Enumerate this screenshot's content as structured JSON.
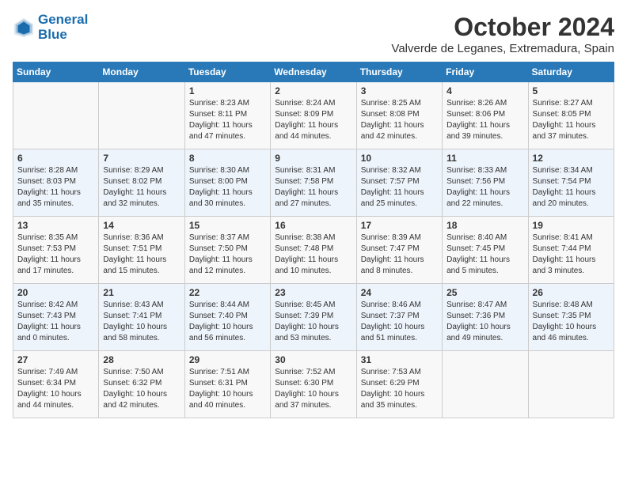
{
  "logo": {
    "line1": "General",
    "line2": "Blue"
  },
  "title": "October 2024",
  "location": "Valverde de Leganes, Extremadura, Spain",
  "weekdays": [
    "Sunday",
    "Monday",
    "Tuesday",
    "Wednesday",
    "Thursday",
    "Friday",
    "Saturday"
  ],
  "weeks": [
    [
      {
        "day": "",
        "sunrise": "",
        "sunset": "",
        "daylight": ""
      },
      {
        "day": "",
        "sunrise": "",
        "sunset": "",
        "daylight": ""
      },
      {
        "day": "1",
        "sunrise": "Sunrise: 8:23 AM",
        "sunset": "Sunset: 8:11 PM",
        "daylight": "Daylight: 11 hours and 47 minutes."
      },
      {
        "day": "2",
        "sunrise": "Sunrise: 8:24 AM",
        "sunset": "Sunset: 8:09 PM",
        "daylight": "Daylight: 11 hours and 44 minutes."
      },
      {
        "day": "3",
        "sunrise": "Sunrise: 8:25 AM",
        "sunset": "Sunset: 8:08 PM",
        "daylight": "Daylight: 11 hours and 42 minutes."
      },
      {
        "day": "4",
        "sunrise": "Sunrise: 8:26 AM",
        "sunset": "Sunset: 8:06 PM",
        "daylight": "Daylight: 11 hours and 39 minutes."
      },
      {
        "day": "5",
        "sunrise": "Sunrise: 8:27 AM",
        "sunset": "Sunset: 8:05 PM",
        "daylight": "Daylight: 11 hours and 37 minutes."
      }
    ],
    [
      {
        "day": "6",
        "sunrise": "Sunrise: 8:28 AM",
        "sunset": "Sunset: 8:03 PM",
        "daylight": "Daylight: 11 hours and 35 minutes."
      },
      {
        "day": "7",
        "sunrise": "Sunrise: 8:29 AM",
        "sunset": "Sunset: 8:02 PM",
        "daylight": "Daylight: 11 hours and 32 minutes."
      },
      {
        "day": "8",
        "sunrise": "Sunrise: 8:30 AM",
        "sunset": "Sunset: 8:00 PM",
        "daylight": "Daylight: 11 hours and 30 minutes."
      },
      {
        "day": "9",
        "sunrise": "Sunrise: 8:31 AM",
        "sunset": "Sunset: 7:58 PM",
        "daylight": "Daylight: 11 hours and 27 minutes."
      },
      {
        "day": "10",
        "sunrise": "Sunrise: 8:32 AM",
        "sunset": "Sunset: 7:57 PM",
        "daylight": "Daylight: 11 hours and 25 minutes."
      },
      {
        "day": "11",
        "sunrise": "Sunrise: 8:33 AM",
        "sunset": "Sunset: 7:56 PM",
        "daylight": "Daylight: 11 hours and 22 minutes."
      },
      {
        "day": "12",
        "sunrise": "Sunrise: 8:34 AM",
        "sunset": "Sunset: 7:54 PM",
        "daylight": "Daylight: 11 hours and 20 minutes."
      }
    ],
    [
      {
        "day": "13",
        "sunrise": "Sunrise: 8:35 AM",
        "sunset": "Sunset: 7:53 PM",
        "daylight": "Daylight: 11 hours and 17 minutes."
      },
      {
        "day": "14",
        "sunrise": "Sunrise: 8:36 AM",
        "sunset": "Sunset: 7:51 PM",
        "daylight": "Daylight: 11 hours and 15 minutes."
      },
      {
        "day": "15",
        "sunrise": "Sunrise: 8:37 AM",
        "sunset": "Sunset: 7:50 PM",
        "daylight": "Daylight: 11 hours and 12 minutes."
      },
      {
        "day": "16",
        "sunrise": "Sunrise: 8:38 AM",
        "sunset": "Sunset: 7:48 PM",
        "daylight": "Daylight: 11 hours and 10 minutes."
      },
      {
        "day": "17",
        "sunrise": "Sunrise: 8:39 AM",
        "sunset": "Sunset: 7:47 PM",
        "daylight": "Daylight: 11 hours and 8 minutes."
      },
      {
        "day": "18",
        "sunrise": "Sunrise: 8:40 AM",
        "sunset": "Sunset: 7:45 PM",
        "daylight": "Daylight: 11 hours and 5 minutes."
      },
      {
        "day": "19",
        "sunrise": "Sunrise: 8:41 AM",
        "sunset": "Sunset: 7:44 PM",
        "daylight": "Daylight: 11 hours and 3 minutes."
      }
    ],
    [
      {
        "day": "20",
        "sunrise": "Sunrise: 8:42 AM",
        "sunset": "Sunset: 7:43 PM",
        "daylight": "Daylight: 11 hours and 0 minutes."
      },
      {
        "day": "21",
        "sunrise": "Sunrise: 8:43 AM",
        "sunset": "Sunset: 7:41 PM",
        "daylight": "Daylight: 10 hours and 58 minutes."
      },
      {
        "day": "22",
        "sunrise": "Sunrise: 8:44 AM",
        "sunset": "Sunset: 7:40 PM",
        "daylight": "Daylight: 10 hours and 56 minutes."
      },
      {
        "day": "23",
        "sunrise": "Sunrise: 8:45 AM",
        "sunset": "Sunset: 7:39 PM",
        "daylight": "Daylight: 10 hours and 53 minutes."
      },
      {
        "day": "24",
        "sunrise": "Sunrise: 8:46 AM",
        "sunset": "Sunset: 7:37 PM",
        "daylight": "Daylight: 10 hours and 51 minutes."
      },
      {
        "day": "25",
        "sunrise": "Sunrise: 8:47 AM",
        "sunset": "Sunset: 7:36 PM",
        "daylight": "Daylight: 10 hours and 49 minutes."
      },
      {
        "day": "26",
        "sunrise": "Sunrise: 8:48 AM",
        "sunset": "Sunset: 7:35 PM",
        "daylight": "Daylight: 10 hours and 46 minutes."
      }
    ],
    [
      {
        "day": "27",
        "sunrise": "Sunrise: 7:49 AM",
        "sunset": "Sunset: 6:34 PM",
        "daylight": "Daylight: 10 hours and 44 minutes."
      },
      {
        "day": "28",
        "sunrise": "Sunrise: 7:50 AM",
        "sunset": "Sunset: 6:32 PM",
        "daylight": "Daylight: 10 hours and 42 minutes."
      },
      {
        "day": "29",
        "sunrise": "Sunrise: 7:51 AM",
        "sunset": "Sunset: 6:31 PM",
        "daylight": "Daylight: 10 hours and 40 minutes."
      },
      {
        "day": "30",
        "sunrise": "Sunrise: 7:52 AM",
        "sunset": "Sunset: 6:30 PM",
        "daylight": "Daylight: 10 hours and 37 minutes."
      },
      {
        "day": "31",
        "sunrise": "Sunrise: 7:53 AM",
        "sunset": "Sunset: 6:29 PM",
        "daylight": "Daylight: 10 hours and 35 minutes."
      },
      {
        "day": "",
        "sunrise": "",
        "sunset": "",
        "daylight": ""
      },
      {
        "day": "",
        "sunrise": "",
        "sunset": "",
        "daylight": ""
      }
    ]
  ]
}
